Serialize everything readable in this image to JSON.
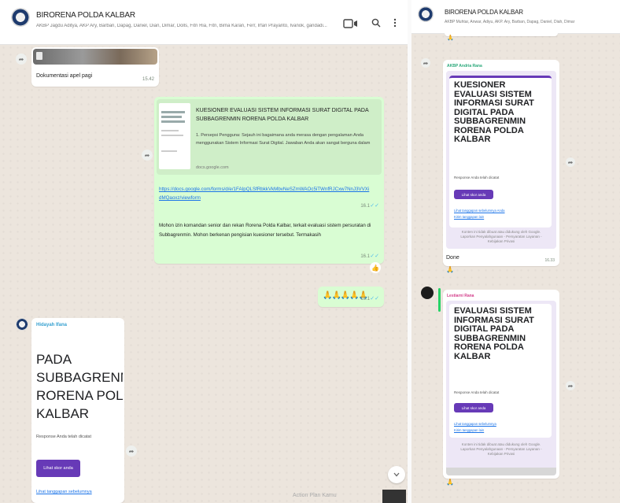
{
  "left": {
    "header": {
      "title": "BIRORENA POLDA KALBAR",
      "subtitle": "AKBP Jagdu Aditya, AKP Ary, Barban, Dapag, Daniel, Dian, Dimar, Dolls, Fitri Ria, Fitri, Bima Karan, Ferr, Irfan Prayanto, Ivanok, gandadi..."
    },
    "doc_bubble": {
      "filename": "Dokumentasi apel pagi",
      "time": "15.42"
    },
    "form_bubble": {
      "title": "KUESIONER EVALUASI SISTEM INFORMASI SURAT DIGITAL PADA SUBBAGRENMIN RORENA POLDA KALBAR",
      "desc": "1. Persepsi Pengguna: Sejauh ini bagaimana anda merasa dengan pengalaman Anda menggunakan Sistem Informasi Surat Digital. Jawaban Anda akan sangat berguna dalam",
      "site": "docs.google.com",
      "url": "https://docs.google.com/forms/d/e/1FAIpQLSfRbkkVkMbvNeSZmWAOc5iTWnfRJCxw7NnJ3VVXidMQaoxz/viewform",
      "url_time": "16.1",
      "text": "Mohon izin komandan senior dan rekan Rorena Polda Kalbar, terkait evaluasi sistem persuratan di Subbagrenmin. Mohon berkenan pengisian kuesioner tersebut. Termakasih",
      "text_time": "16.1",
      "reaction": "👍"
    },
    "emoji_bubble": {
      "emojis": "🙏🙏🙏🙏🙏",
      "time": "16.1"
    },
    "received_card": {
      "sender": "Hidayah Ifana",
      "title": "PADA SUBBAGRENMIN RORENA POLDA KALBAR",
      "note": "Response Anda telah dicatat",
      "button": "Lihat skor anda",
      "link": "Lihat tanggapan sebelumnya"
    },
    "bottom_label": "Action Plan Kamu",
    "scroll_icon": "chevron-down-icon"
  },
  "right": {
    "header": {
      "title": "BIRORENA POLDA KALBAR",
      "subtitle": "AKBP Muhtar, Anwar, Adiyu, AKP. Ary, Barban, Dapag, Daniel, Diah, Dimar"
    },
    "card1": {
      "sender": "AKBP Andria Rana",
      "title": "KUESIONER EVALUASI SISTEM INFORMASI SURAT DIGITAL PADA SUBBAGRENMIN RORENA POLDA KALBAR",
      "note": "Response Anda telah dicatat",
      "button": "Lihat skor anda",
      "link1": "Lihat tanggapan sebelumnya Anda",
      "link2": "Kirim tanggapan lain",
      "fineprint": "Konten ini tidak dibuat atau didukung oleh Google. Laporkan Penyalahgunaan - Persyaratan Layanan - Kebijakan Privasi",
      "caption": "Done",
      "time": "16.33",
      "reaction": "🙏"
    },
    "card2": {
      "sender": "Lestiarni Rana",
      "title": "EVALUASI SISTEM INFORMASI SURAT DIGITAL PADA SUBBAGRENMIN RORENA POLDA KALBAR",
      "note": "Response Anda telah dicatat",
      "button": "Lihat skor anda",
      "link1": "Lihat tanggapan sebelumnya",
      "link2": "Kirim tanggapan lain",
      "fineprint": "Konten ini tidak dibuat atau didukung oleh Google. Laporkan Penyalahgunaan - Persyaratan Layanan - Kebijakan Privasi",
      "reaction": "🙏"
    }
  },
  "colors": {
    "bubble_out": "#d9fdd3",
    "forms_purple": "#673ab7",
    "link": "#1a73e8"
  }
}
